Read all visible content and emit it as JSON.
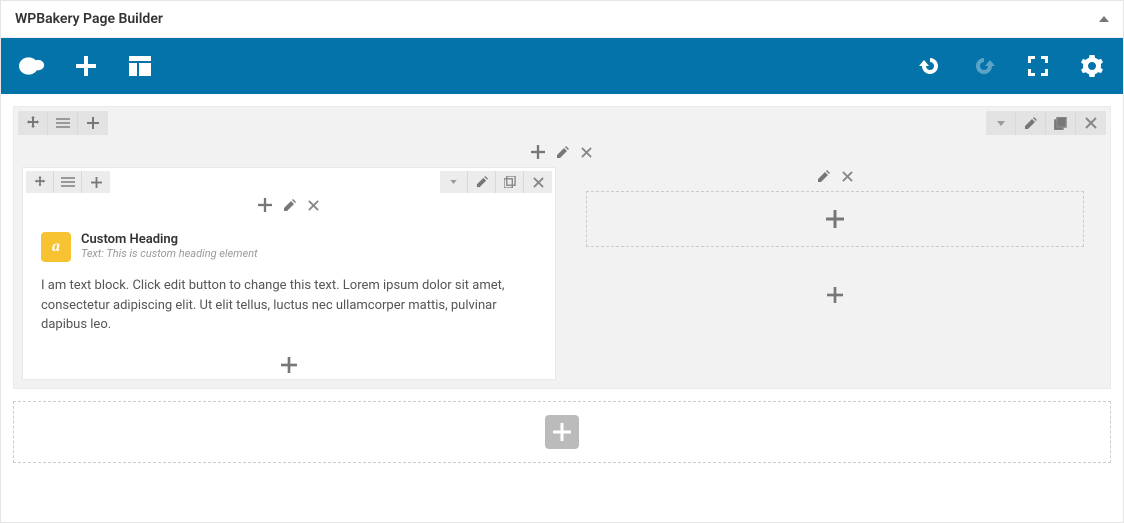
{
  "panel": {
    "title": "WPBakery Page Builder"
  },
  "elements": {
    "custom_heading": {
      "icon_glyph": "a",
      "title": "Custom Heading",
      "subtitle": "Text: This is custom heading element"
    },
    "text_block": {
      "content": "I am text block. Click edit button to change this text. Lorem ipsum dolor sit amet, consectetur adipiscing elit. Ut elit tellus, luctus nec ullamcorper mattis, pulvinar dapibus leo."
    }
  }
}
